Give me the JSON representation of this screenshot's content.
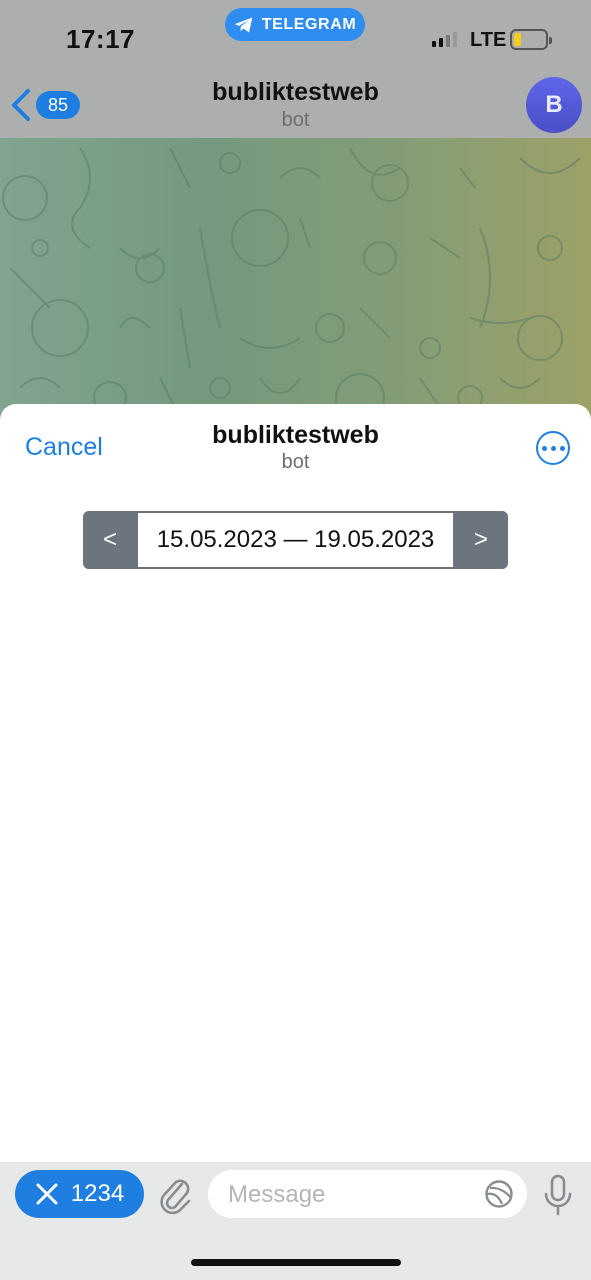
{
  "status_bar": {
    "time": "17:17",
    "app_pill": "TELEGRAM",
    "network": "LTE"
  },
  "nav": {
    "back_count": "85",
    "title": "bubliktestweb",
    "subtitle": "bot",
    "avatar_letter": "B"
  },
  "sheet": {
    "cancel_label": "Cancel",
    "title": "bubliktestweb",
    "subtitle": "bot",
    "range": {
      "prev_label": "<",
      "dates": "15.05.2023 — 19.05.2023",
      "next_label": ">"
    }
  },
  "bottom_bar": {
    "keyboard_button_label": "1234",
    "message_placeholder": "Message"
  },
  "colors": {
    "accent": "#1f7fe0",
    "telegram_pill": "#2f8cf0",
    "range_button": "#6c757d",
    "avatar": "#5a5fd9"
  },
  "icons": [
    "telegram-plane-icon",
    "back-chevron-icon",
    "more-dots-icon",
    "close-x-icon",
    "paperclip-icon",
    "sticker-icon",
    "microphone-icon"
  ]
}
